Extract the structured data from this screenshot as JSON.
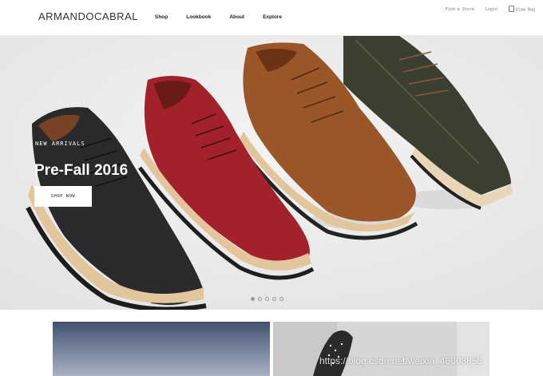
{
  "brand": {
    "logo_text": "ARMANDOCABRAL"
  },
  "nav": {
    "items": [
      "Shop",
      "Lookbook",
      "About",
      "Explore"
    ]
  },
  "utility": {
    "find_store": "Find a Store",
    "login": "Login",
    "view_bag": "View Bag",
    "bag_icon": "bag-icon"
  },
  "hero": {
    "kicker": "NEW ARRIVALS",
    "headline": "Pre-Fall 2016",
    "cta_label": "SHOP NOW",
    "slides": {
      "count": 5,
      "active_index": 0
    },
    "shoe_colors": [
      "#2a2a2c",
      "#a3212c",
      "#9a5528",
      "#3a3f2f"
    ]
  },
  "watermark": "https://blog.csdn.net/weixin_46008855"
}
